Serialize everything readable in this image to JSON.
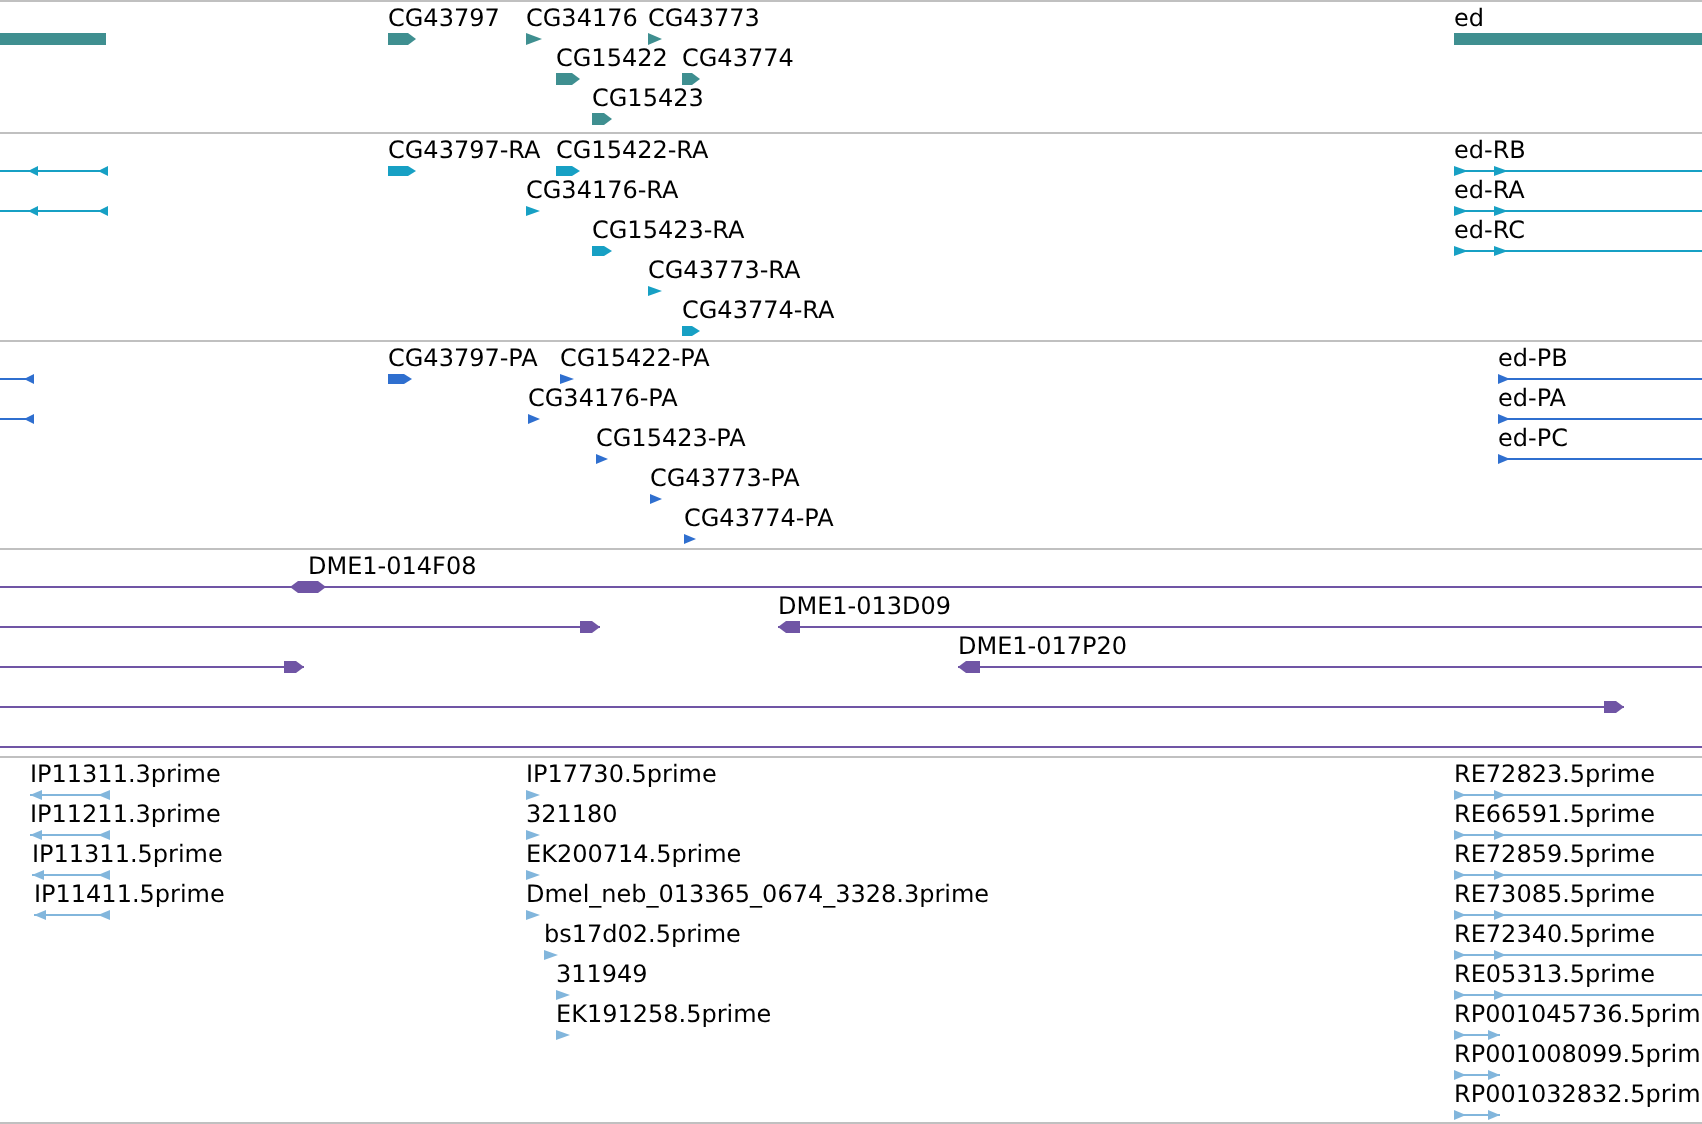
{
  "tracks": [
    {
      "kind": "gene",
      "color": "#3f8f90",
      "features": [
        {
          "kind": "plain"
        },
        {
          "label": "CG43797",
          "kind": "forward"
        },
        {
          "label": "CG34176",
          "kind": "forward"
        },
        {
          "label": "CG43773",
          "kind": "forward"
        },
        {
          "label": "ed",
          "kind": "plain"
        },
        {
          "label": "CG15422",
          "kind": "forward"
        },
        {
          "label": "CG43774",
          "kind": "forward"
        },
        {
          "label": "CG15423",
          "kind": "forward"
        }
      ]
    },
    {
      "kind": "transcript",
      "color": "#17a0c4",
      "features": [
        {
          "kind": "reverse"
        },
        {
          "label": "CG43797-RA",
          "kind": "forward"
        },
        {
          "label": "CG15422-RA",
          "kind": "forward"
        },
        {
          "label": "ed-RB",
          "kind": "forward"
        },
        {
          "kind": "reverse"
        },
        {
          "label": "CG34176-RA",
          "kind": "forward"
        },
        {
          "label": "ed-RA",
          "kind": "forward"
        },
        {
          "label": "CG15423-RA",
          "kind": "forward"
        },
        {
          "label": "ed-RC",
          "kind": "forward"
        },
        {
          "label": "CG43773-RA",
          "kind": "forward"
        },
        {
          "label": "CG43774-RA",
          "kind": "forward"
        }
      ]
    },
    {
      "kind": "protein",
      "color": "#2f6fcf",
      "features": [
        {
          "kind": "reverse"
        },
        {
          "label": "CG43797-PA",
          "kind": "forward"
        },
        {
          "label": "CG15422-PA",
          "kind": "forward"
        },
        {
          "label": "ed-PB",
          "kind": "forward"
        },
        {
          "kind": "reverse"
        },
        {
          "label": "CG34176-PA",
          "kind": "forward"
        },
        {
          "label": "ed-PA",
          "kind": "forward"
        },
        {
          "label": "CG15423-PA",
          "kind": "forward"
        },
        {
          "label": "ed-PC",
          "kind": "forward"
        },
        {
          "label": "CG43773-PA",
          "kind": "forward"
        },
        {
          "label": "CG43774-PA",
          "kind": "forward"
        }
      ]
    },
    {
      "kind": "clone",
      "color": "#7055a5",
      "features": [
        {
          "label": "DME1-014F08",
          "kind": "both"
        },
        {
          "kind": "forward"
        },
        {
          "label": "DME1-013D09",
          "kind": "reverse"
        },
        {
          "kind": "forward"
        },
        {
          "label": "DME1-017P20",
          "kind": "reverse"
        },
        {
          "kind": "forward"
        },
        {
          "kind": "plain"
        }
      ]
    },
    {
      "kind": "est",
      "color": "#82b6dc",
      "features": [
        {
          "label": "IP11311.3prime",
          "kind": "reverse"
        },
        {
          "label": "IP17730.5prime",
          "kind": "forward"
        },
        {
          "label": "RE72823.5prime",
          "kind": "forward"
        },
        {
          "label": "IP11211.3prime",
          "kind": "reverse"
        },
        {
          "label": "321180",
          "kind": "forward"
        },
        {
          "label": "RE66591.5prime",
          "kind": "forward"
        },
        {
          "label": "IP11311.5prime",
          "kind": "reverse"
        },
        {
          "label": "EK200714.5prime",
          "kind": "forward"
        },
        {
          "label": "RE72859.5prime",
          "kind": "forward"
        },
        {
          "label": "IP11411.5prime",
          "kind": "reverse"
        },
        {
          "label": "Dmel_neb_013365_0674_3328.3prime",
          "kind": "forward"
        },
        {
          "label": "RE73085.5prime",
          "kind": "forward"
        },
        {
          "label": "bs17d02.5prime",
          "kind": "forward"
        },
        {
          "label": "RE72340.5prime",
          "kind": "forward"
        },
        {
          "label": "311949",
          "kind": "forward"
        },
        {
          "label": "RE05313.5prime",
          "kind": "forward"
        },
        {
          "label": "EK191258.5prime",
          "kind": "forward"
        },
        {
          "label": "RP001045736.5prim",
          "kind": "forward"
        },
        {
          "label": "RP001008099.5prim",
          "kind": "forward"
        },
        {
          "label": "RP001032832.5prim",
          "kind": "forward"
        }
      ]
    }
  ]
}
